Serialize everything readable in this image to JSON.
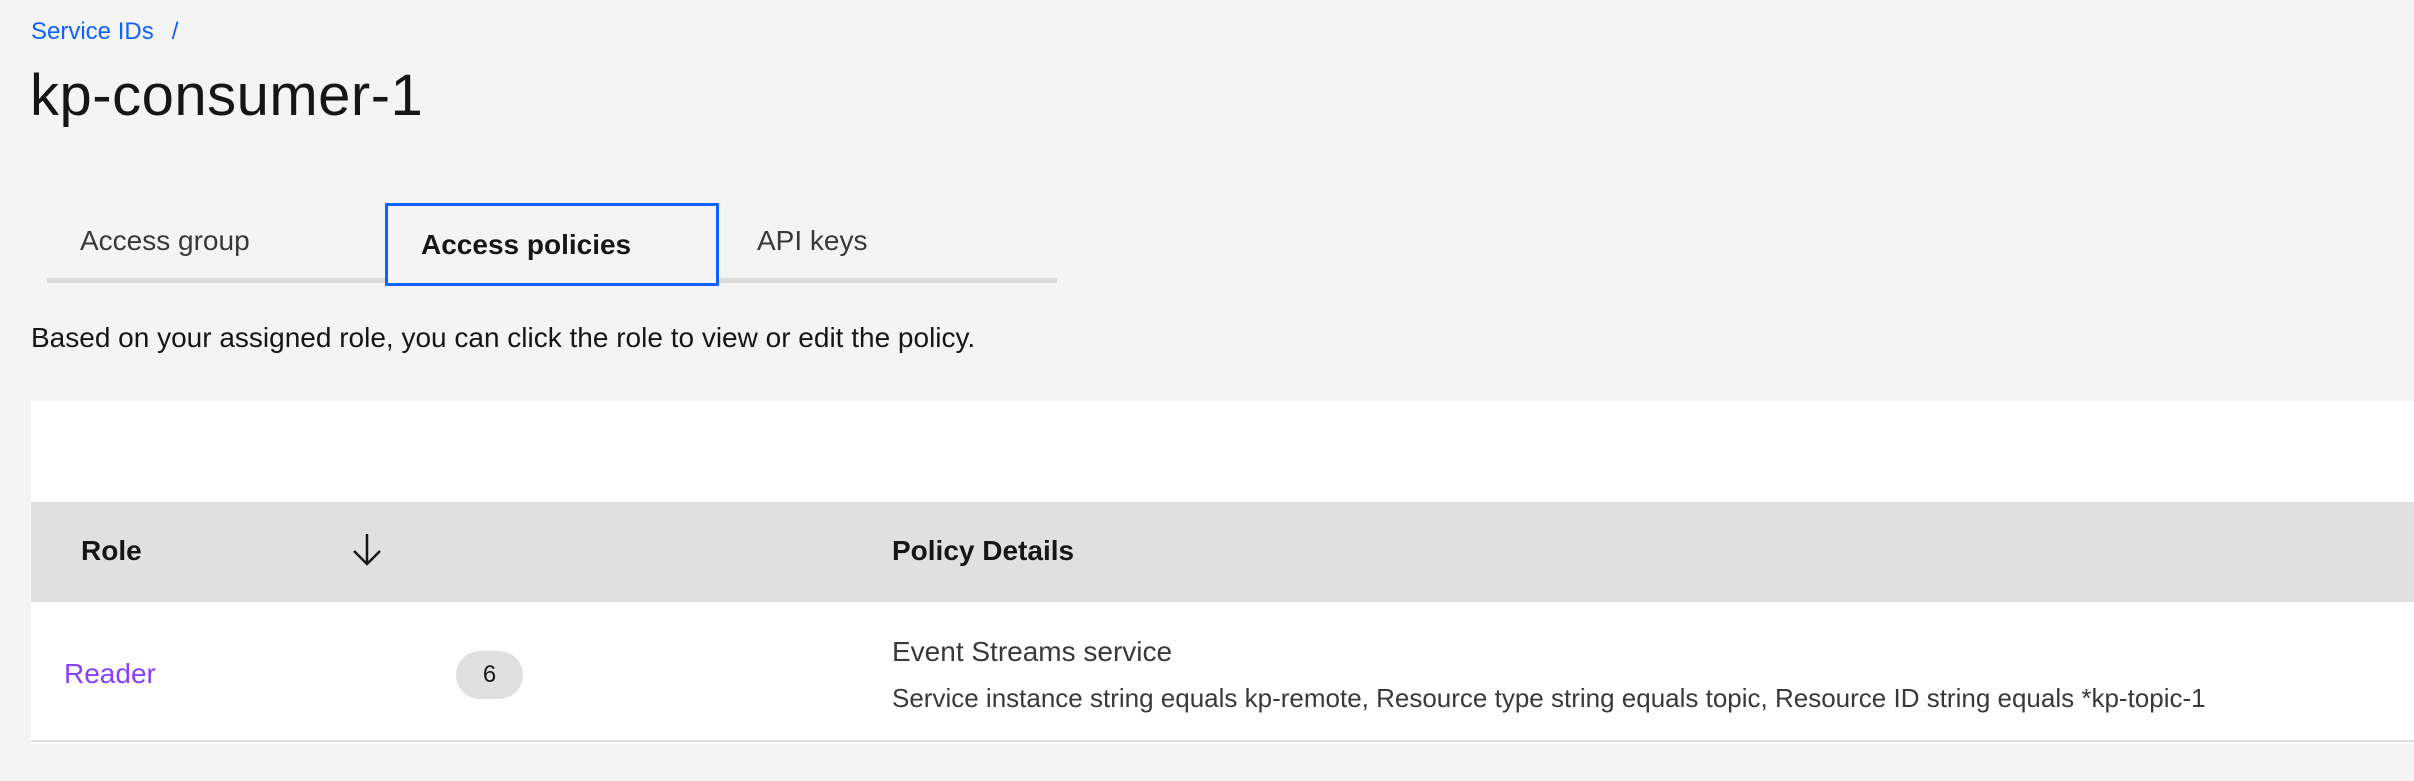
{
  "breadcrumb": {
    "parent": "Service IDs",
    "separator": "/"
  },
  "page": {
    "title": "kp-consumer-1"
  },
  "tabs": [
    {
      "label": "Access group",
      "selected": false
    },
    {
      "label": "Access policies",
      "selected": true
    },
    {
      "label": "API keys",
      "selected": false
    }
  ],
  "instructions": "Based on your assigned role, you can click the role to view or edit the policy.",
  "table": {
    "headers": {
      "role": "Role",
      "policy_details": "Policy Details"
    },
    "sort_icon": "arrow-down-icon",
    "rows": [
      {
        "role": "Reader",
        "count": "6",
        "service": "Event Streams service",
        "details": "Service instance string equals kp-remote, Resource type string equals topic, Resource ID string equals *kp-topic-1"
      }
    ]
  },
  "colors": {
    "link": "#0f62fe",
    "role_link": "#8a3ffc",
    "tab_focus": "#0f62fe",
    "header_bg": "#e0e0e0",
    "page_bg": "#f4f4f4"
  }
}
